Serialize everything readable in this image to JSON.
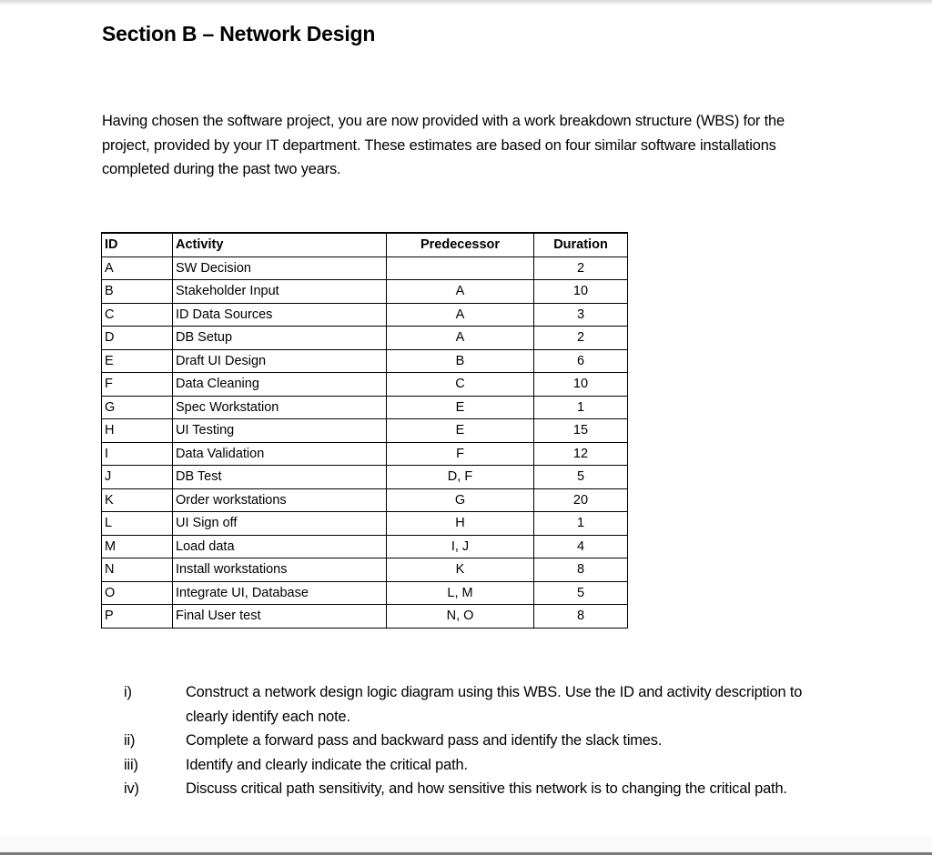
{
  "section_title": "Section B – Network Design",
  "intro": "Having chosen the software project, you are now provided with a work breakdown structure (WBS) for the project, provided by your IT department. These estimates are based on four similar software installations completed during the past two years.",
  "table": {
    "headers": [
      "ID",
      "Activity",
      "Predecessor",
      "Duration"
    ],
    "rows": [
      {
        "id": "A",
        "activity": "SW Decision",
        "predecessor": "",
        "duration": "2"
      },
      {
        "id": "B",
        "activity": "Stakeholder Input",
        "predecessor": "A",
        "duration": "10"
      },
      {
        "id": "C",
        "activity": "ID Data Sources",
        "predecessor": "A",
        "duration": "3"
      },
      {
        "id": "D",
        "activity": "DB Setup",
        "predecessor": "A",
        "duration": "2"
      },
      {
        "id": "E",
        "activity": "Draft UI Design",
        "predecessor": "B",
        "duration": "6"
      },
      {
        "id": "F",
        "activity": "Data Cleaning",
        "predecessor": "C",
        "duration": "10"
      },
      {
        "id": "G",
        "activity": "Spec Workstation",
        "predecessor": "E",
        "duration": "1"
      },
      {
        "id": "H",
        "activity": "UI Testing",
        "predecessor": "E",
        "duration": "15"
      },
      {
        "id": "I",
        "activity": "Data Validation",
        "predecessor": "F",
        "duration": "12"
      },
      {
        "id": "J",
        "activity": "DB Test",
        "predecessor": "D, F",
        "duration": "5"
      },
      {
        "id": "K",
        "activity": "Order workstations",
        "predecessor": "G",
        "duration": "20"
      },
      {
        "id": "L",
        "activity": "UI Sign off",
        "predecessor": "H",
        "duration": "1"
      },
      {
        "id": "M",
        "activity": "Load data",
        "predecessor": "I, J",
        "duration": "4"
      },
      {
        "id": "N",
        "activity": "Install workstations",
        "predecessor": "K",
        "duration": "8"
      },
      {
        "id": "O",
        "activity": "Integrate UI, Database",
        "predecessor": "L, M",
        "duration": "5"
      },
      {
        "id": "P",
        "activity": "Final User test",
        "predecessor": "N, O",
        "duration": "8"
      }
    ]
  },
  "questions": [
    {
      "num": "i)",
      "text": "Construct a network design logic diagram using this WBS. Use the ID and activity description to clearly identify each note."
    },
    {
      "num": "ii)",
      "text": "Complete a forward pass and backward pass and identify the slack times."
    },
    {
      "num": "iii)",
      "text": "Identify and clearly indicate the critical path."
    },
    {
      "num": "iv)",
      "text": "Discuss critical path sensitivity, and how sensitive this network is to changing the critical path."
    }
  ]
}
